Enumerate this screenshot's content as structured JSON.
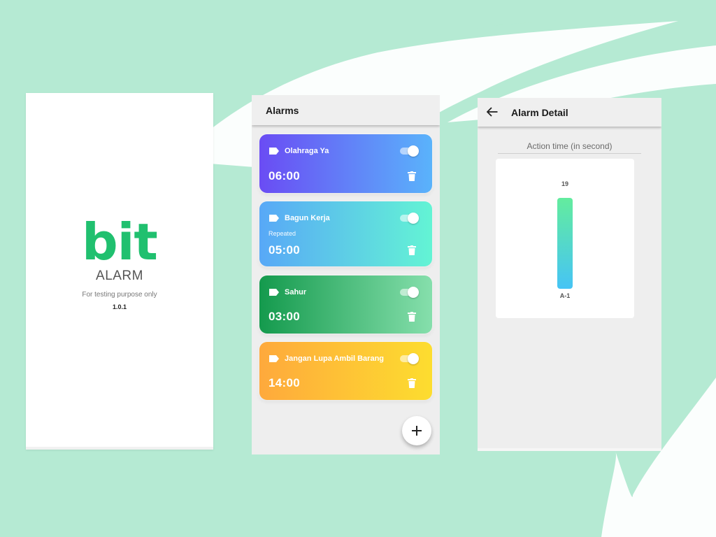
{
  "splash": {
    "logo_primary": "bit",
    "logo_secondary": "ALARM",
    "tagline": "For testing purpose only",
    "version": "1.0.1"
  },
  "alarms_screen": {
    "title": "Alarms",
    "alarms": [
      {
        "label": "Olahraga Ya",
        "repeat": "",
        "time": "06:00",
        "enabled": true,
        "gradient": [
          "#6a4cf4",
          "#5ab3fb"
        ]
      },
      {
        "label": "Bagun Kerja",
        "repeat": "Repeated",
        "time": "05:00",
        "enabled": true,
        "gradient": [
          "#58a8f7",
          "#63f4d4"
        ]
      },
      {
        "label": "Sahur",
        "repeat": "",
        "time": "03:00",
        "enabled": true,
        "gradient": [
          "#149a4d",
          "#86dfac"
        ]
      },
      {
        "label": "Jangan Lupa Ambil Barang",
        "repeat": "",
        "time": "14:00",
        "enabled": true,
        "gradient": [
          "#fea93c",
          "#fddd2f"
        ]
      }
    ],
    "fab_icon": "plus-icon",
    "icons": {
      "label": "tag-icon",
      "delete": "trash-icon"
    }
  },
  "detail_screen": {
    "title": "Alarm Detail",
    "back_icon": "arrow-left-icon",
    "section_title": "Action time (in second)"
  },
  "colors": {
    "background": "#b5ead3",
    "brand_green": "#20c06f",
    "bar_top": "#63ec9e",
    "bar_bottom": "#46c4f5"
  },
  "chart_data": {
    "type": "bar",
    "categories": [
      "A-1"
    ],
    "values": [
      19
    ],
    "title": "",
    "xlabel": "",
    "ylabel": "",
    "ylim": [
      0,
      19
    ]
  }
}
